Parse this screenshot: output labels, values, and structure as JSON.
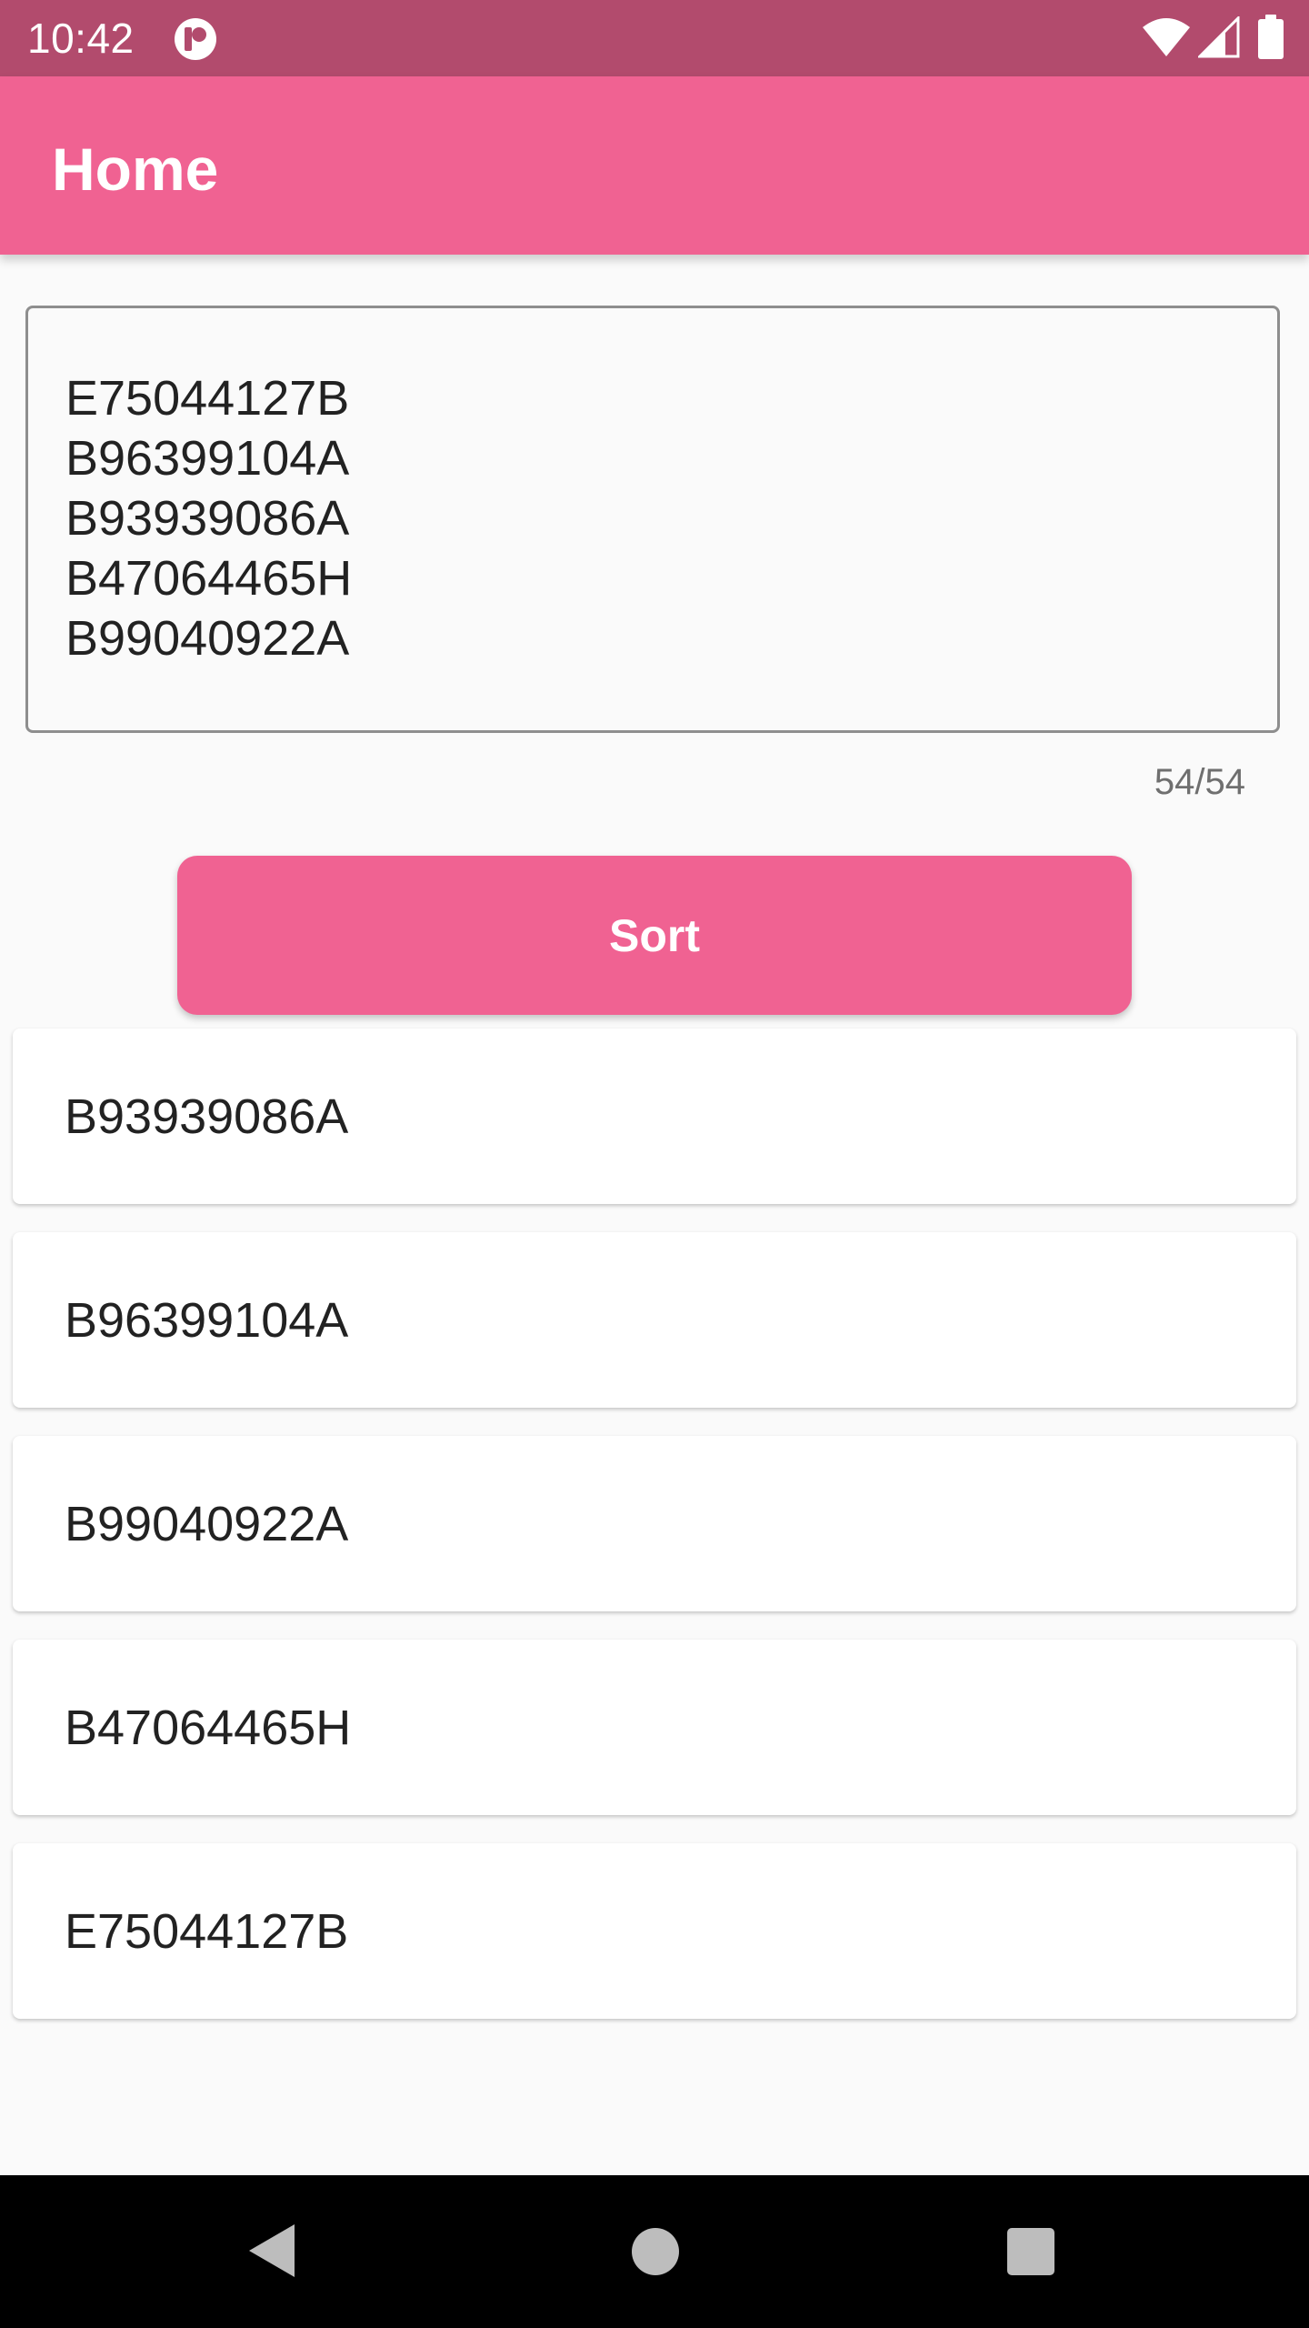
{
  "status_bar": {
    "time": "10:42",
    "app_icon": "notification-app-icon",
    "wifi_icon": "wifi-icon",
    "signal_icon": "cell-signal-icon",
    "battery_icon": "battery-icon"
  },
  "app_bar": {
    "title": "Home"
  },
  "input": {
    "value": "E75044127B\nB96399104A\nB93939086A\nB47064465H\nB99040922A",
    "counter": "54/54"
  },
  "sort_button": {
    "label": "Sort"
  },
  "results": [
    "B93939086A",
    "B96399104A",
    "B99040922A",
    "B47064465H",
    "E75044127B"
  ],
  "nav_bar": {
    "back_icon": "back-triangle-icon",
    "home_icon": "home-circle-icon",
    "recents_icon": "recents-square-icon"
  },
  "colors": {
    "status_bar": "#b24b6d",
    "primary": "#f06292",
    "background": "#fafafa",
    "card": "#ffffff",
    "nav_bar": "#000000"
  }
}
